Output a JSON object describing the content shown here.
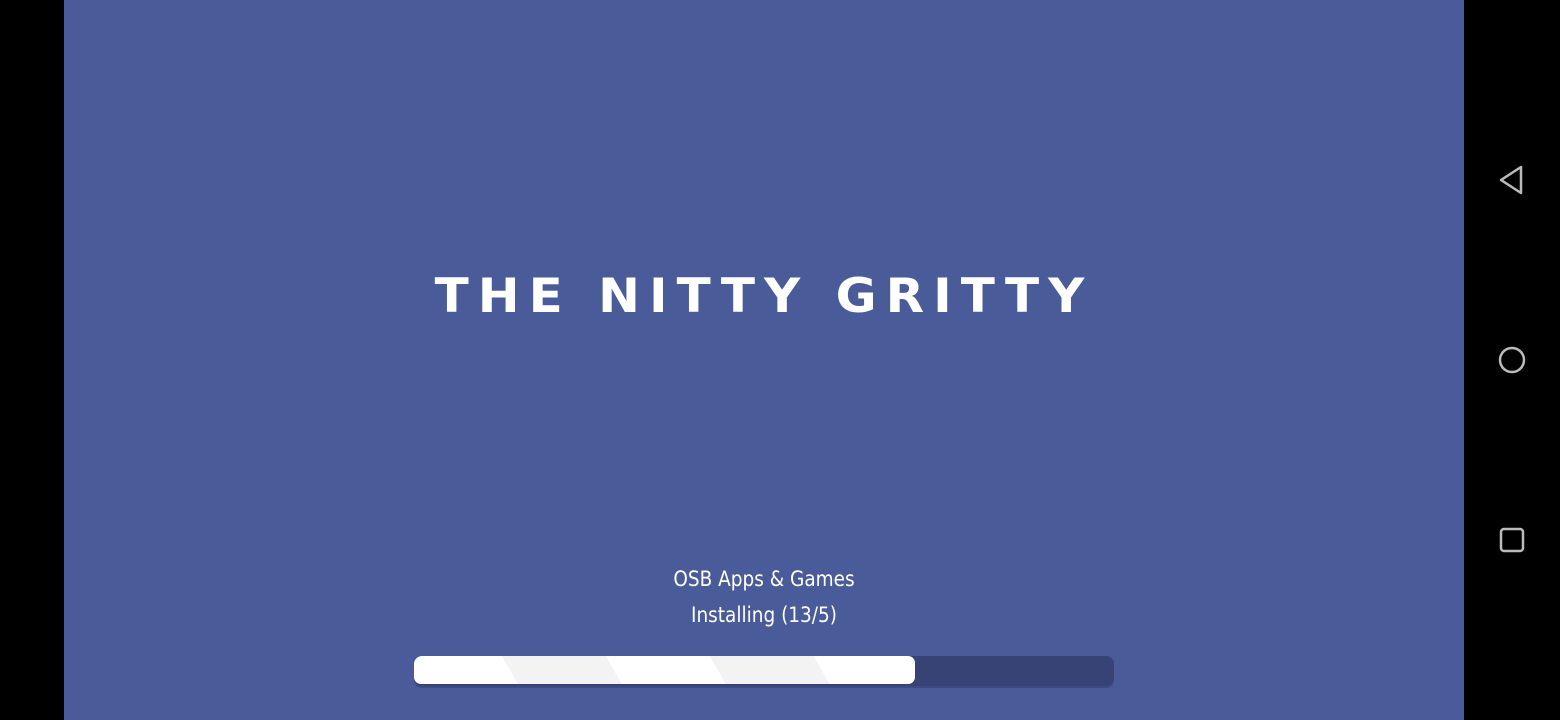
{
  "app": {
    "title": "THE NITTY GRITTY",
    "publisher": "OSB Apps & Games",
    "status": "Installing (13/5)",
    "progress_percent": 71.6,
    "colors": {
      "background": "#4a5b99",
      "bar_track": "#384375",
      "bar_fill": "#ffffff"
    }
  },
  "navbar": {
    "icons": [
      "back-icon",
      "home-icon",
      "recents-icon"
    ]
  }
}
